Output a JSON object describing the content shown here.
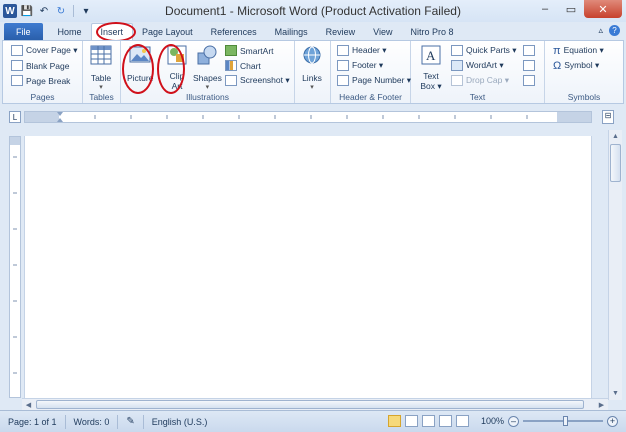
{
  "window": {
    "title": "Document1 - Microsoft Word (Product Activation Failed)",
    "logo": "W",
    "minimize": "–",
    "restore": "▭",
    "close": "✕",
    "qat_save": "💾",
    "qat_undo": "↶",
    "qat_redo": "↻",
    "qat_more": "▾"
  },
  "tabs": [
    "File",
    "Home",
    "Insert",
    "Page Layout",
    "References",
    "Mailings",
    "Review",
    "View",
    "Nitro Pro 8"
  ],
  "tabs_right": {
    "minimize_ribbon": "▵",
    "help": "?"
  },
  "ribbon": {
    "pages": {
      "label": "Pages",
      "items": [
        "Cover Page ▾",
        "Blank Page",
        "Page Break"
      ]
    },
    "tables": {
      "label": "Tables",
      "table": "Table",
      "caret": "▾"
    },
    "illustrations": {
      "label": "Illustrations",
      "picture": "Picture",
      "clip_art_1": "Clip",
      "clip_art_2": "Art",
      "shapes": "Shapes",
      "shapes_caret": "▾",
      "smartart": "SmartArt",
      "chart": "Chart",
      "screenshot": "Screenshot ▾"
    },
    "links": {
      "label": "",
      "links": "Links",
      "caret": "▾"
    },
    "header_footer": {
      "label": "Header & Footer",
      "items": [
        "Header ▾",
        "Footer ▾",
        "Page Number ▾"
      ]
    },
    "text": {
      "label": "Text",
      "text_box_1": "Text",
      "text_box_2": "Box ▾",
      "items": [
        "Quick Parts ▾",
        "WordArt ▾",
        "Drop Cap ▾"
      ]
    },
    "symbols": {
      "label": "Symbols",
      "items": [
        "Equation ▾",
        "Symbol ▾"
      ],
      "equation_glyph": "π",
      "symbol_glyph": "Ω"
    }
  },
  "ruler": {
    "tab_selector": "L",
    "toggle": "⊟"
  },
  "status": {
    "page": "Page: 1 of 1",
    "words": "Words: 0",
    "language": "English (U.S.)",
    "zoom": "100%",
    "zoom_minus": "–",
    "zoom_plus": "+"
  },
  "scroll": {
    "up": "▲",
    "down": "▼",
    "left": "◀",
    "right": "▶"
  },
  "colors": {
    "accent": "#2b579a",
    "highlight": "#d0101a"
  }
}
